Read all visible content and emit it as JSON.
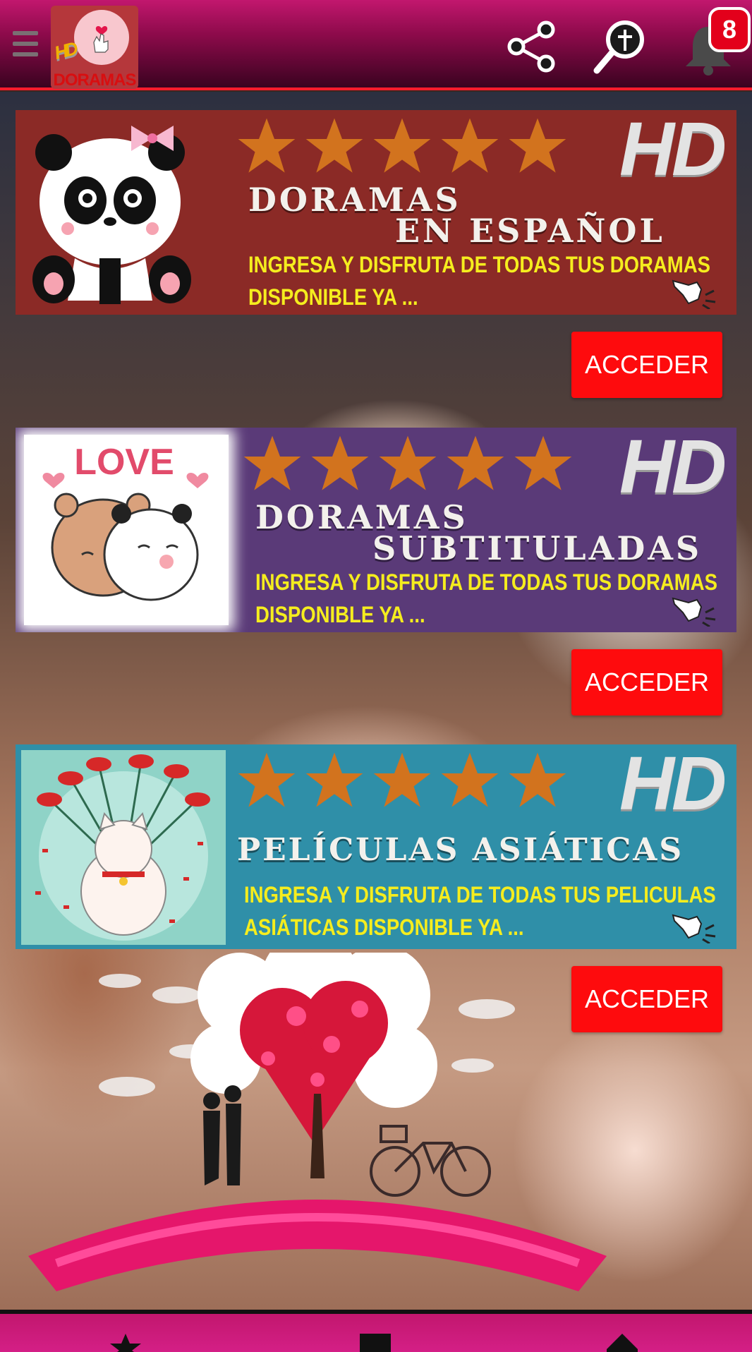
{
  "header": {
    "menu_icon": "hamburger-menu-icon",
    "logo": {
      "badge_text": "HD",
      "name": "DORAMAS"
    },
    "share_icon": "share-icon",
    "search_icon": "search-cross-icon",
    "bell_icon": "notification-bell-icon",
    "notification_count": "8"
  },
  "banners": [
    {
      "thumbnail": "panda-with-bow",
      "rating_stars": 5,
      "hd": "HD",
      "title_line1": "DORAMAS",
      "title_line2": "EN ESPAÑOL",
      "desc_line1": "INGRESA Y DISFRUTA DE TODAS TUS DORAMAS",
      "desc_line2": "DISPONIBLE YA ...",
      "button": "ACCEDER",
      "color": "#8b2a26"
    },
    {
      "thumbnail": "love-bears",
      "thumbnail_text": "LOVE",
      "rating_stars": 5,
      "hd": "HD",
      "title_line1": "DORAMAS",
      "title_line2": "SUBTITULADAS",
      "desc_line1": "INGRESA Y DISFRUTA DE TODAS TUS DORAMAS",
      "desc_line2": "DISPONIBLE YA ...",
      "button": "ACCEDER",
      "color": "#5a3a78"
    },
    {
      "thumbnail": "cat-with-flowers",
      "rating_stars": 5,
      "hd": "HD",
      "title_line1": "PELÍCULAS ASIÁTICAS",
      "desc_line1": "INGRESA Y DISFRUTA DE TODAS TUS PELICULAS",
      "desc_line2": "ASIÁTICAS DISPONIBLE YA ...",
      "button": "ACCEDER",
      "color": "#2f8fa8"
    }
  ],
  "colors": {
    "header": "#8c0a4a",
    "accent_red": "#fe0b0d",
    "star": "#d2731e",
    "desc_text": "#f5ed1e"
  },
  "bottom_nav": [
    "star-icon",
    "square-icon",
    "home-icon"
  ]
}
